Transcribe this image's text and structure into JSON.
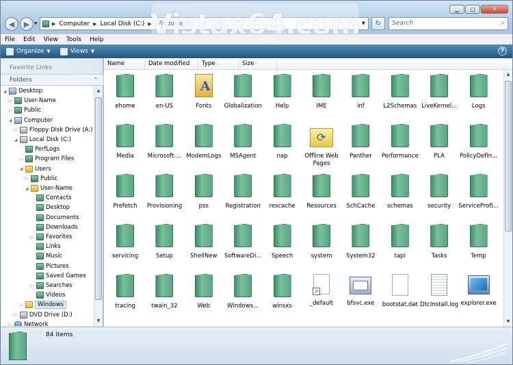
{
  "address": {
    "segments": [
      "Computer",
      "Local Disk (C:)",
      "Windows"
    ]
  },
  "search": {
    "placeholder": "Search"
  },
  "watermark": "Vistax64.com",
  "menu": [
    "File",
    "Edit",
    "View",
    "Tools",
    "Help"
  ],
  "toolbar": {
    "organize": "Organize",
    "views": "Views"
  },
  "navpane": {
    "favorite_links": "Favorite Links",
    "folders": "Folders",
    "tree": [
      {
        "label": "Desktop",
        "indent": 0,
        "icon": "desktop-icon",
        "twisty": "open"
      },
      {
        "label": "User-Name",
        "indent": 1,
        "icon": "folder-icon",
        "twisty": "closed"
      },
      {
        "label": "Public",
        "indent": 1,
        "icon": "folder-icon",
        "twisty": "closed"
      },
      {
        "label": "Computer",
        "indent": 1,
        "icon": "computer-icon",
        "twisty": "open"
      },
      {
        "label": "Floppy Disk Drive (A:)",
        "indent": 2,
        "icon": "floppy-icon",
        "twisty": "closed"
      },
      {
        "label": "Local Disk (C:)",
        "indent": 2,
        "icon": "drive-icon",
        "twisty": "open"
      },
      {
        "label": "PerfLogs",
        "indent": 3,
        "icon": "folder-icon",
        "twisty": "none"
      },
      {
        "label": "Program Files",
        "indent": 3,
        "icon": "folder-icon",
        "twisty": "closed"
      },
      {
        "label": "Users",
        "indent": 3,
        "icon": "folder-yellow-icon",
        "twisty": "open"
      },
      {
        "label": "Public",
        "indent": 4,
        "icon": "folder-icon",
        "twisty": "closed"
      },
      {
        "label": "User-Name",
        "indent": 4,
        "icon": "folder-yellow-icon",
        "twisty": "open"
      },
      {
        "label": "Contacts",
        "indent": 5,
        "icon": "folder-icon",
        "twisty": "none"
      },
      {
        "label": "Desktop",
        "indent": 5,
        "icon": "folder-icon",
        "twisty": "none"
      },
      {
        "label": "Documents",
        "indent": 5,
        "icon": "folder-icon",
        "twisty": "none"
      },
      {
        "label": "Downloads",
        "indent": 5,
        "icon": "folder-icon",
        "twisty": "none"
      },
      {
        "label": "Favorites",
        "indent": 5,
        "icon": "folder-icon",
        "twisty": "closed"
      },
      {
        "label": "Links",
        "indent": 5,
        "icon": "folder-icon",
        "twisty": "none"
      },
      {
        "label": "Music",
        "indent": 5,
        "icon": "folder-icon",
        "twisty": "none"
      },
      {
        "label": "Pictures",
        "indent": 5,
        "icon": "folder-icon",
        "twisty": "none"
      },
      {
        "label": "Saved Games",
        "indent": 5,
        "icon": "folder-icon",
        "twisty": "none"
      },
      {
        "label": "Searches",
        "indent": 5,
        "icon": "folder-icon",
        "twisty": "closed"
      },
      {
        "label": "Videos",
        "indent": 5,
        "icon": "folder-icon",
        "twisty": "none"
      },
      {
        "label": "Windows",
        "indent": 3,
        "icon": "folder-yellow-icon",
        "twisty": "closed",
        "selected": true
      },
      {
        "label": "DVD Drive (D:)",
        "indent": 2,
        "icon": "dvd-icon",
        "twisty": "closed"
      },
      {
        "label": "Network",
        "indent": 1,
        "icon": "network-icon",
        "twisty": "closed"
      }
    ]
  },
  "columns": [
    "Name",
    "Date modified",
    "Type",
    "Size"
  ],
  "items": [
    {
      "name": "ehome",
      "kind": "folder"
    },
    {
      "name": "en-US",
      "kind": "folder"
    },
    {
      "name": "Fonts",
      "kind": "fonts"
    },
    {
      "name": "Globalization",
      "kind": "folder"
    },
    {
      "name": "Help",
      "kind": "folder"
    },
    {
      "name": "IME",
      "kind": "folder"
    },
    {
      "name": "inf",
      "kind": "folder"
    },
    {
      "name": "L2Schemas",
      "kind": "folder"
    },
    {
      "name": "LiveKernel...",
      "kind": "folder"
    },
    {
      "name": "Logs",
      "kind": "folder"
    },
    {
      "name": "Media",
      "kind": "folder"
    },
    {
      "name": "Microsoft....",
      "kind": "folder"
    },
    {
      "name": "ModemLogs",
      "kind": "folder"
    },
    {
      "name": "MSAgent",
      "kind": "folder"
    },
    {
      "name": "nap",
      "kind": "folder"
    },
    {
      "name": "Offline Web Pages",
      "kind": "offline"
    },
    {
      "name": "Panther",
      "kind": "folder"
    },
    {
      "name": "Performance",
      "kind": "folder"
    },
    {
      "name": "PLA",
      "kind": "folder"
    },
    {
      "name": "PolicyDefin...",
      "kind": "folder"
    },
    {
      "name": "Prefetch",
      "kind": "folder"
    },
    {
      "name": "Provisioning",
      "kind": "folder"
    },
    {
      "name": "pss",
      "kind": "folder"
    },
    {
      "name": "Registration",
      "kind": "folder"
    },
    {
      "name": "rescache",
      "kind": "folder"
    },
    {
      "name": "Resources",
      "kind": "folder"
    },
    {
      "name": "SchCache",
      "kind": "folder"
    },
    {
      "name": "schemas",
      "kind": "folder"
    },
    {
      "name": "security",
      "kind": "folder"
    },
    {
      "name": "ServiceProfi...",
      "kind": "folder"
    },
    {
      "name": "servicing",
      "kind": "folder"
    },
    {
      "name": "Setup",
      "kind": "folder"
    },
    {
      "name": "ShellNew",
      "kind": "folder"
    },
    {
      "name": "SoftwareDi...",
      "kind": "folder"
    },
    {
      "name": "Speech",
      "kind": "folder"
    },
    {
      "name": "system",
      "kind": "folder"
    },
    {
      "name": "System32",
      "kind": "folder"
    },
    {
      "name": "tapi",
      "kind": "folder"
    },
    {
      "name": "Tasks",
      "kind": "folder"
    },
    {
      "name": "Temp",
      "kind": "folder"
    },
    {
      "name": "tracing",
      "kind": "folder"
    },
    {
      "name": "twain_32",
      "kind": "folder"
    },
    {
      "name": "Web",
      "kind": "folder"
    },
    {
      "name": "Windows...",
      "kind": "folder"
    },
    {
      "name": "winsxs",
      "kind": "folder"
    },
    {
      "name": "_default",
      "kind": "shortcut"
    },
    {
      "name": "bfsvc.exe",
      "kind": "exe"
    },
    {
      "name": "bootstat.dat",
      "kind": "doc"
    },
    {
      "name": "DtcInstall.log",
      "kind": "log"
    },
    {
      "name": "explorer.exe",
      "kind": "explorer"
    }
  ],
  "status": {
    "count": "84 items"
  }
}
